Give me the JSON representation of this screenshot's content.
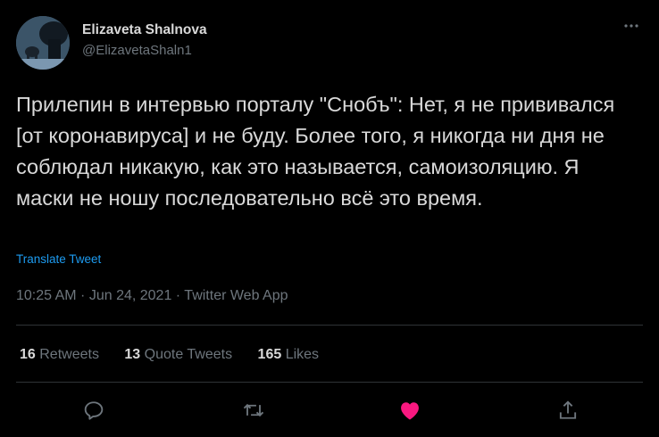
{
  "author": {
    "display_name": "Elizaveta Shalnova",
    "handle": "@ElizavetaShaln1"
  },
  "tweet": {
    "text": "Прилепин в интервью порталу \"Снобъ\": Нет, я не прививался [от коронавируса] и не буду. Более того, я никогда ни дня не соблюдал никакую, как это называется, самоизоляцию. Я маски не ношу последовательно всё это время.",
    "translate_label": "Translate Tweet",
    "time": "10:25 AM",
    "date": "Jun 24, 2021",
    "source": "Twitter Web App",
    "separator": " · "
  },
  "stats": {
    "retweets": {
      "count": "16",
      "label": "Retweets"
    },
    "quote_tweets": {
      "count": "13",
      "label": "Quote Tweets"
    },
    "likes": {
      "count": "165",
      "label": "Likes"
    }
  },
  "actions": [
    {
      "name": "reply",
      "icon": "reply-icon"
    },
    {
      "name": "retweet",
      "icon": "retweet-icon"
    },
    {
      "name": "like",
      "icon": "heart-icon",
      "active": true
    },
    {
      "name": "share",
      "icon": "share-icon"
    }
  ],
  "colors": {
    "background": "#000000",
    "text": "#d9d9d9",
    "secondary_text": "#6e767d",
    "link": "#1d9bf0",
    "like": "#f91880",
    "divider": "#2f3336"
  }
}
